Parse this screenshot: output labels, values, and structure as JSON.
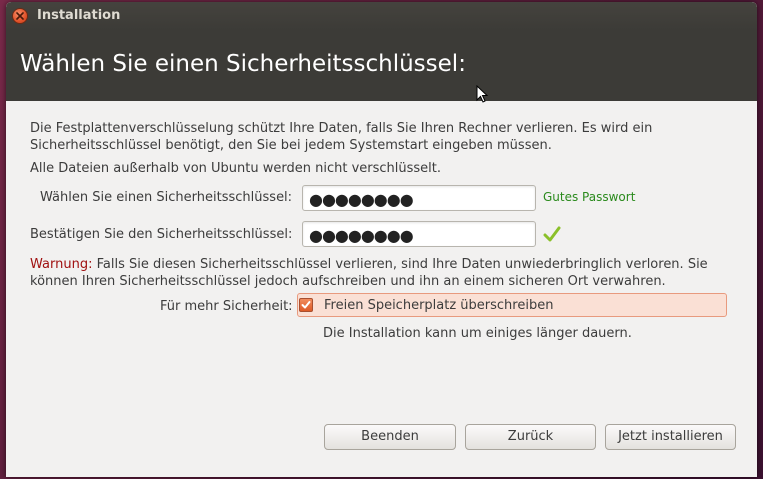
{
  "window": {
    "title": "Installation"
  },
  "page": {
    "title": "Wählen Sie einen Sicherheitsschlüssel:"
  },
  "description": {
    "line1": "Die Festplattenverschlüsselung schützt Ihre Daten, falls Sie Ihren Rechner verlieren. Es wird ein",
    "line2": "Sicherheitsschlüssel benötigt, den Sie bei jedem Systemstart eingeben müssen.",
    "line3": "Alle Dateien außerhalb von Ubuntu werden nicht verschlüsselt."
  },
  "key_field": {
    "label": "Wählen Sie einen Sicherheitsschlüssel:",
    "masked_value": "●●●●●●●●",
    "strength": "Gutes Passwort"
  },
  "confirm_field": {
    "label": "Bestätigen Sie den Sicherheitsschlüssel:",
    "masked_value": "●●●●●●●●"
  },
  "warning": {
    "label": "Warnung:",
    "text_line1": " Falls Sie diesen Sicherheitsschlüssel verlieren, sind Ihre Daten unwiederbringlich verloren. Sie",
    "text_line2": "können Ihren Sicherheitsschlüssel jedoch aufschreiben und ihn an einem sicheren Ort verwahren."
  },
  "security": {
    "label": "Für mehr Sicherheit:",
    "checkbox_label": "Freien Speicherplatz überschreiben",
    "checked": true,
    "note": "Die Installation kann um einiges länger dauern."
  },
  "buttons": {
    "quit": "Beenden",
    "back": "Zurück",
    "install": "Jetzt installieren"
  },
  "colors": {
    "header": "#3c3b37",
    "strength_ok": "#2a8a1c",
    "warning": "#a01010",
    "accent": "#dd4814"
  }
}
